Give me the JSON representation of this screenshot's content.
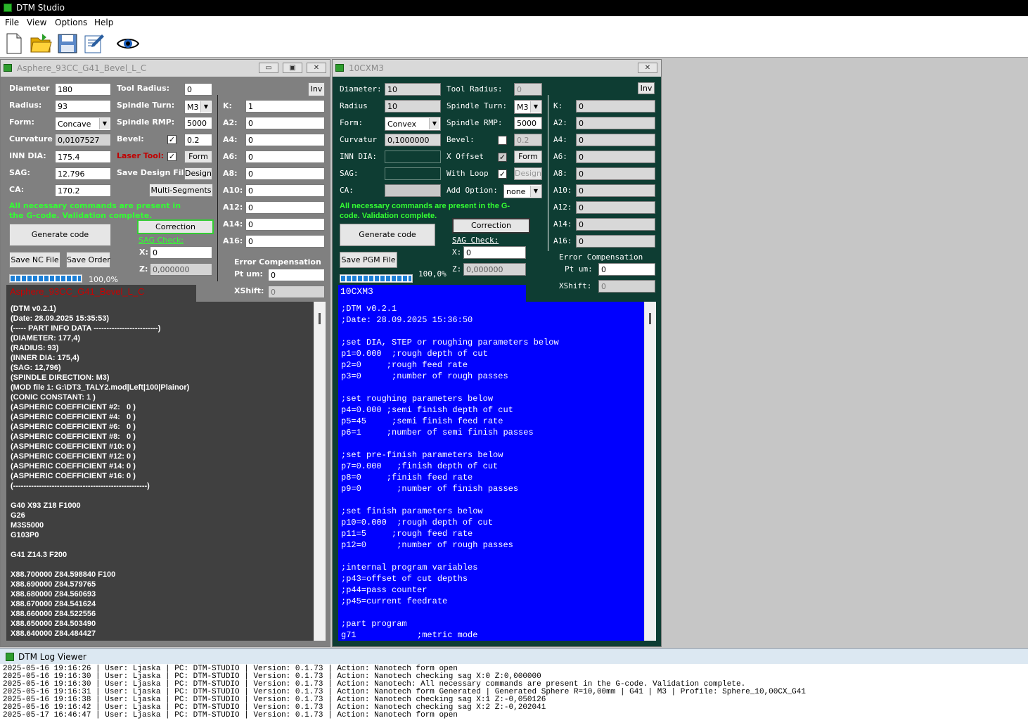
{
  "app": {
    "title": "DTM Studio"
  },
  "menu": [
    "File",
    "View",
    "Options",
    "Help"
  ],
  "toolbar": {
    "icons": [
      "new-file-icon",
      "open-folder-icon",
      "save-disk-icon",
      "edit-document-icon",
      "eye-icon"
    ]
  },
  "win1": {
    "title": "Asphere_93CC_G41_Bevel_L_C",
    "labels": {
      "diameter": "Diameter",
      "radius": "Radius:",
      "form": "Form:",
      "curvature": "Curvature",
      "inn_dia": "INN DIA:",
      "sag": "SAG:",
      "ca": "CA:",
      "tool_radius": "Tool Radius:",
      "spindle_turn": "Spindle Turn:",
      "spindle_rmp": "Spindle RMP:",
      "bevel": "Bevel:",
      "laser_tool": "Laser Tool:",
      "save_design_file": "Save Design File:",
      "k": "K:",
      "a2": "A2:",
      "a4": "A4:",
      "a6": "A6:",
      "a8": "A8:",
      "a10": "A10:",
      "a12": "A12:",
      "a14": "A14:",
      "a16": "A16:",
      "error_comp": "Error Compensation",
      "pt_um": "Pt um:",
      "xshift": "XShift:",
      "x": "X:",
      "z": "Z:"
    },
    "values": {
      "diameter": "180",
      "radius": "93",
      "form": "Concave",
      "curvature": "0,0107527",
      "inn_dia": "175.4",
      "sag": "12.796",
      "ca": "170.2",
      "tool_radius": "0",
      "spindle_turn": "M3",
      "spindle_rmp": "5000",
      "bevel": "0.2",
      "k": "1",
      "a2": "0",
      "a4": "0",
      "a6": "0",
      "a8": "0",
      "a10": "0",
      "a12": "0",
      "a14": "0",
      "a16": "0",
      "pt_um": "0",
      "xshift": "0",
      "x": "0",
      "z": "0,000000"
    },
    "buttons": {
      "inv": "Inv",
      "form": "Form",
      "design": "Design",
      "multi": "Multi-Segments",
      "generate": "Generate code",
      "correction": "Correction",
      "save_nc": "Save NC File",
      "save_order": "Save Order"
    },
    "status": "All necessary commands are present in the G-code. Validation complete.",
    "sag_check": "SAG Check:",
    "progress": "100,0%",
    "progress_value": 1.0,
    "file_name": "Asphere_93CC_G41_Bevel_L_C",
    "code": [
      "(DTM v0.2.1)",
      "(Date: 28.09.2025 15:35:53)",
      "(----- PART INFO DATA -------------------------)",
      "(DIAMETER: 177,4)",
      "(RADIUS: 93)",
      "(INNER DIA: 175,4)",
      "(SAG: 12,796)",
      "(SPINDLE DIRECTION: M3)",
      "(MOD file 1: G:\\DT3_TALY2.mod|Left|100|Plainor)",
      "(CONIC CONSTANT: 1 )",
      "(ASPHERIC COEFFICIENT #2:   0 )",
      "(ASPHERIC COEFFICIENT #4:   0 )",
      "(ASPHERIC COEFFICIENT #6:   0 )",
      "(ASPHERIC COEFFICIENT #8:   0 )",
      "(ASPHERIC COEFFICIENT #10: 0 )",
      "(ASPHERIC COEFFICIENT #12: 0 )",
      "(ASPHERIC COEFFICIENT #14: 0 )",
      "(ASPHERIC COEFFICIENT #16: 0 )",
      "(----------------------------------------------------)",
      "",
      "G40 X93 Z18 F1000",
      "G26",
      "M3S5000",
      "G103P0",
      "",
      "G41 Z14.3 F200",
      "",
      "X88.700000 Z84.598840 F100",
      "X88.690000 Z84.579765",
      "X88.680000 Z84.560693",
      "X88.670000 Z84.541624",
      "X88.660000 Z84.522556",
      "X88.650000 Z84.503490",
      "X88.640000 Z84.484427"
    ]
  },
  "win2": {
    "title": "10CXM3",
    "labels": {
      "diameter": "Diameter:",
      "radius": "Radius",
      "form": "Form:",
      "curvatur": "Curvatur",
      "inn_dia": "INN DIA:",
      "sag": "SAG:",
      "ca": "CA:",
      "tool_radius": "Tool Radius:",
      "spindle_turn": "Spindle Turn:",
      "spindle_rmp": "Spindle RMP:",
      "bevel": "Bevel:",
      "x_offset": "X Offset",
      "with_loop": "With Loop",
      "add_option": "Add Option:",
      "k": "K:",
      "a2": "A2:",
      "a4": "A4:",
      "a6": "A6:",
      "a8": "A8:",
      "a10": "A10:",
      "a12": "A12:",
      "a14": "A14:",
      "a16": "A16:",
      "error_comp": "Error Compensation",
      "pt_um": "Pt um:",
      "xshift": "XShift:",
      "x": "X:",
      "z": "Z:"
    },
    "values": {
      "diameter": "10",
      "radius": "10",
      "form": "Convex",
      "curvatur": "0,1000000",
      "inn_dia": "",
      "sag": "",
      "ca": "",
      "tool_radius": "0",
      "spindle_turn": "M3",
      "spindle_rmp": "5000",
      "bevel": "0.2",
      "add_option": "none",
      "k": "0",
      "a2": "0",
      "a4": "0",
      "a6": "0",
      "a8": "0",
      "a10": "0",
      "a12": "0",
      "a14": "0",
      "a16": "0",
      "pt_um": "0",
      "xshift": "0",
      "x": "0",
      "z": "0,000000"
    },
    "buttons": {
      "inv": "Inv",
      "form": "Form",
      "design": "Design",
      "generate": "Generate code",
      "correction": "Correction",
      "save_pgm": "Save PGM File"
    },
    "status": "All necessary commands are present in the G-code. Validation complete.",
    "sag_check": "SAG Check:",
    "progress": "100,0%",
    "progress_value": 1.0,
    "file_name": "10CXM3",
    "code": [
      ";DTM v0.2.1",
      ";Date: 28.09.2025 15:36:50",
      "",
      ";set DIA, STEP or roughing parameters below",
      "p1=0.000  ;rough depth of cut",
      "p2=0     ;rough feed rate",
      "p3=0      ;number of rough passes",
      "",
      ";set roughing parameters below",
      "p4=0.000 ;semi finish depth of cut",
      "p5=45     ;semi finish feed rate",
      "p6=1     ;number of semi finish passes",
      "",
      ";set pre-finish parameters below",
      "p7=0.000   ;finish depth of cut",
      "p8=0     ;finish feed rate",
      "p9=0       ;number of finish passes",
      "",
      ";set finish parameters below",
      "p10=0.000  ;rough depth of cut",
      "p11=5     ;rough feed rate",
      "p12=0      ;number of rough passes",
      "",
      ";internal program variables",
      ";p43=offset of cut depths",
      ";p44=pass counter",
      ";p45=current feedrate",
      "",
      ";part program",
      "g71            ;metric mode"
    ]
  },
  "log": {
    "title": "DTM Log Viewer",
    "lines": [
      "2025-05-16 19:16:26 | User: Ljaska | PC: DTM-STUDIO | Version: 0.1.73 | Action: Nanotech form open",
      "2025-05-16 19:16:30 | User: Ljaska | PC: DTM-STUDIO | Version: 0.1.73 | Action: Nanotech checking sag X:0 Z:0,000000",
      "2025-05-16 19:16:30 | User: Ljaska | PC: DTM-STUDIO | Version: 0.1.73 | Action: Nanotech: All necessary commands are present in the G-code. Validation complete.",
      "2025-05-16 19:16:31 | User: Ljaska | PC: DTM-STUDIO | Version: 0.1.73 | Action: Nanotech form Generated | Generated Sphere R=10,00mm | G41 | M3 | Profile: Sphere_10,00CX_G41",
      "2025-05-16 19:16:38 | User: Ljaska | PC: DTM-STUDIO | Version: 0.1.73 | Action: Nanotech checking sag X:1 Z:-0,050126",
      "2025-05-16 19:16:42 | User: Ljaska | PC: DTM-STUDIO | Version: 0.1.73 | Action: Nanotech checking sag X:2 Z:-0,202041",
      "2025-05-17 16:46:47 | User: Ljaska | PC: DTM-STUDIO | Version: 0.1.73 | Action: Nanotech form open"
    ]
  },
  "colors": {
    "status_green": "#33ff33",
    "laser_red": "#c00000",
    "filename_red": "#cc0000",
    "code_bg_left": "#404040",
    "code_bg_right": "#0000ff",
    "right_bg": "#0e3d33",
    "left_bg": "#808080"
  }
}
